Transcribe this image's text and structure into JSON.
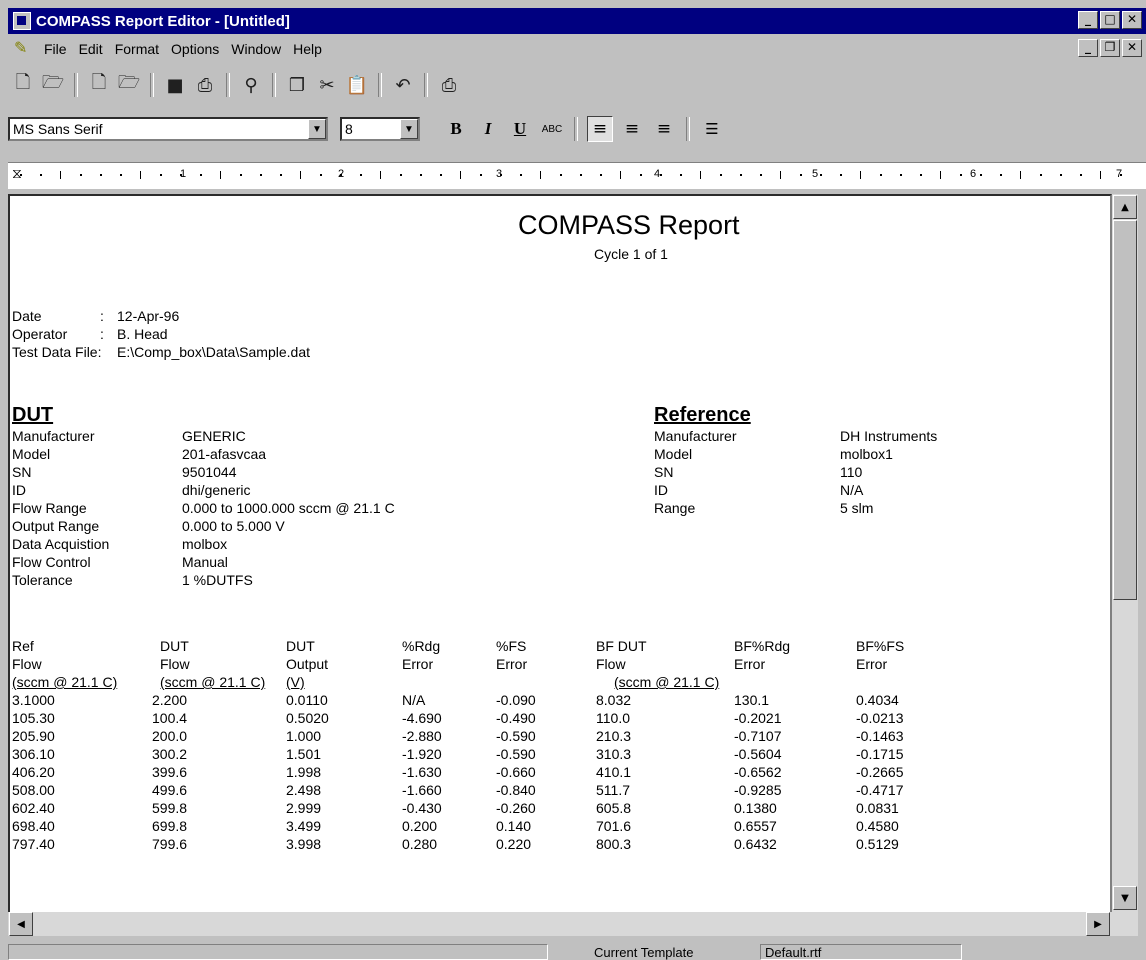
{
  "window": {
    "title": "COMPASS Report Editor - [Untitled]"
  },
  "menu": {
    "items": [
      "File",
      "Edit",
      "Format",
      "Options",
      "Window",
      "Help"
    ]
  },
  "toolbar": {
    "icons": [
      "new-report-icon",
      "open-icon",
      "new-template-icon",
      "open-template-icon",
      "save-icon",
      "print-icon",
      "find-icon",
      "copy-icon",
      "cut-icon",
      "paste-icon",
      "undo-icon",
      "print-preview-icon"
    ]
  },
  "format": {
    "font": "MS Sans Serif",
    "size": "8"
  },
  "ruler": {
    "numbers": [
      "1",
      "2",
      "3",
      "4",
      "5",
      "6",
      "7"
    ]
  },
  "report": {
    "title": "COMPASS Report",
    "cycle": "Cycle 1 of  1",
    "date_label": "Date",
    "date_value": "12-Apr-96",
    "operator_label": "Operator",
    "operator_value": "B. Head",
    "file_label": "Test Data File:",
    "file_value": "E:\\Comp_box\\Data\\Sample.dat",
    "dut": {
      "heading": "DUT",
      "fields": [
        {
          "label": "Manufacturer",
          "value": "GENERIC"
        },
        {
          "label": "Model",
          "value": "201-afasvcaa"
        },
        {
          "label": "SN",
          "value": "9501044"
        },
        {
          "label": "ID",
          "value": "dhi/generic"
        },
        {
          "label": "Flow Range",
          "value": "0.000 to 1000.000 sccm @ 21.1 C"
        },
        {
          "label": "Output Range",
          "value": "0.000 to 5.000 V"
        },
        {
          "label": "Data Acquistion",
          "value": "molbox"
        },
        {
          "label": "Flow Control",
          "value": "Manual"
        },
        {
          "label": "Tolerance",
          "value": "1 %DUTFS"
        }
      ]
    },
    "reference": {
      "heading": "Reference",
      "fields": [
        {
          "label": "Manufacturer",
          "value": "DH Instruments"
        },
        {
          "label": "Model",
          "value": "molbox1"
        },
        {
          "label": "SN",
          "value": "110"
        },
        {
          "label": "ID",
          "value": "N/A"
        },
        {
          "label": "Range",
          "value": "5 slm"
        }
      ]
    },
    "table": {
      "headers1": [
        "Ref",
        "DUT",
        "DUT",
        "%Rdg",
        "%FS",
        "BF DUT",
        "BF%Rdg",
        "BF%FS"
      ],
      "headers2": [
        "Flow",
        "Flow",
        "Output",
        "Error",
        "Error",
        "Flow",
        "Error",
        "Error"
      ],
      "units": [
        "(sccm @ 21.1 C)",
        "(sccm @ 21.1 C)",
        "(V)",
        "(sccm @ 21.1 C)"
      ],
      "rows": [
        [
          "3.1000",
          "2.200",
          "0.0110",
          "N/A",
          "-0.090",
          "8.032",
          "130.1",
          "0.4034"
        ],
        [
          "105.30",
          "100.4",
          "0.5020",
          "-4.690",
          "-0.490",
          "110.0",
          "-0.2021",
          "-0.0213"
        ],
        [
          "205.90",
          "200.0",
          "1.000",
          "-2.880",
          "-0.590",
          "210.3",
          "-0.7107",
          "-0.1463"
        ],
        [
          "306.10",
          "300.2",
          "1.501",
          "-1.920",
          "-0.590",
          "310.3",
          "-0.5604",
          "-0.1715"
        ],
        [
          "406.20",
          "399.6",
          "1.998",
          "-1.630",
          "-0.660",
          "410.1",
          "-0.6562",
          "-0.2665"
        ],
        [
          "508.00",
          "499.6",
          "2.498",
          "-1.660",
          "-0.840",
          "511.7",
          "-0.9285",
          "-0.4717"
        ],
        [
          "602.40",
          "599.8",
          "2.999",
          "-0.430",
          "-0.260",
          "605.8",
          "0.1380",
          "0.0831"
        ],
        [
          "698.40",
          "699.8",
          "3.499",
          "0.200",
          "0.140",
          "701.6",
          "0.6557",
          "0.4580"
        ],
        [
          "797.40",
          "799.6",
          "3.998",
          "0.280",
          "0.220",
          "800.3",
          "0.6432",
          "0.5129"
        ]
      ]
    }
  },
  "status": {
    "template_label": "Current Template",
    "template_value": "Default.rtf"
  }
}
